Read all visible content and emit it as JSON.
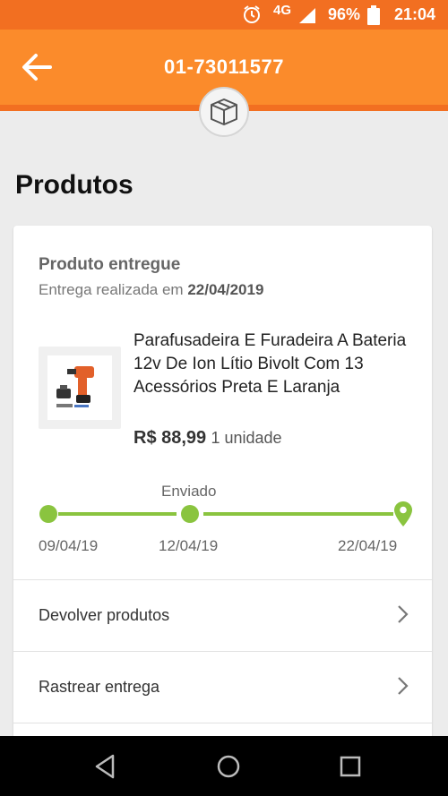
{
  "status_bar": {
    "network": "4G",
    "battery": "96%",
    "time": "21:04"
  },
  "app_bar": {
    "title": "01-73011577"
  },
  "section": {
    "title": "Produtos"
  },
  "order": {
    "status_title": "Produto entregue",
    "status_sub_prefix": "Entrega realizada em",
    "status_sub_date": "22/04/2019",
    "product_name": "Parafusadeira E Furadeira A Bateria 12v De Ion Lítio Bivolt Com 13 Acessórios Preta E Laranja",
    "price": "R$ 88,99",
    "quantity": "1 unidade",
    "timeline": {
      "middle_label": "Enviado",
      "dates": [
        "09/04/19",
        "12/04/19",
        "22/04/19"
      ],
      "progress": 1.0
    }
  },
  "actions": [
    {
      "label": "Devolver produtos"
    },
    {
      "label": "Rastrear entrega"
    }
  ],
  "colors": {
    "accent": "#fb8b2b",
    "accent_dark": "#f26f21",
    "progress": "#8ac43f"
  }
}
